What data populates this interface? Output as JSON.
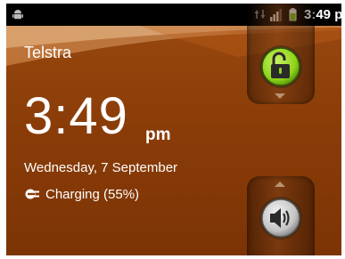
{
  "status_bar": {
    "time": "3:49 pm",
    "icons": [
      "android-notification-icon",
      "data-activity-icon",
      "signal-strength-icon",
      "battery-charging-icon"
    ]
  },
  "lockscreen": {
    "carrier": "Telstra",
    "clock_time": "3:49",
    "clock_ampm": "pm",
    "date": "Wednesday, 7 September",
    "charging_status": "Charging (55%)",
    "unlock_icon": "unlock-padlock-icon",
    "sound_icon": "speaker-sound-icon"
  },
  "colors": {
    "background": "#8a3c08",
    "unlock_green": "#8fd41a",
    "status_bar": "#000000"
  }
}
